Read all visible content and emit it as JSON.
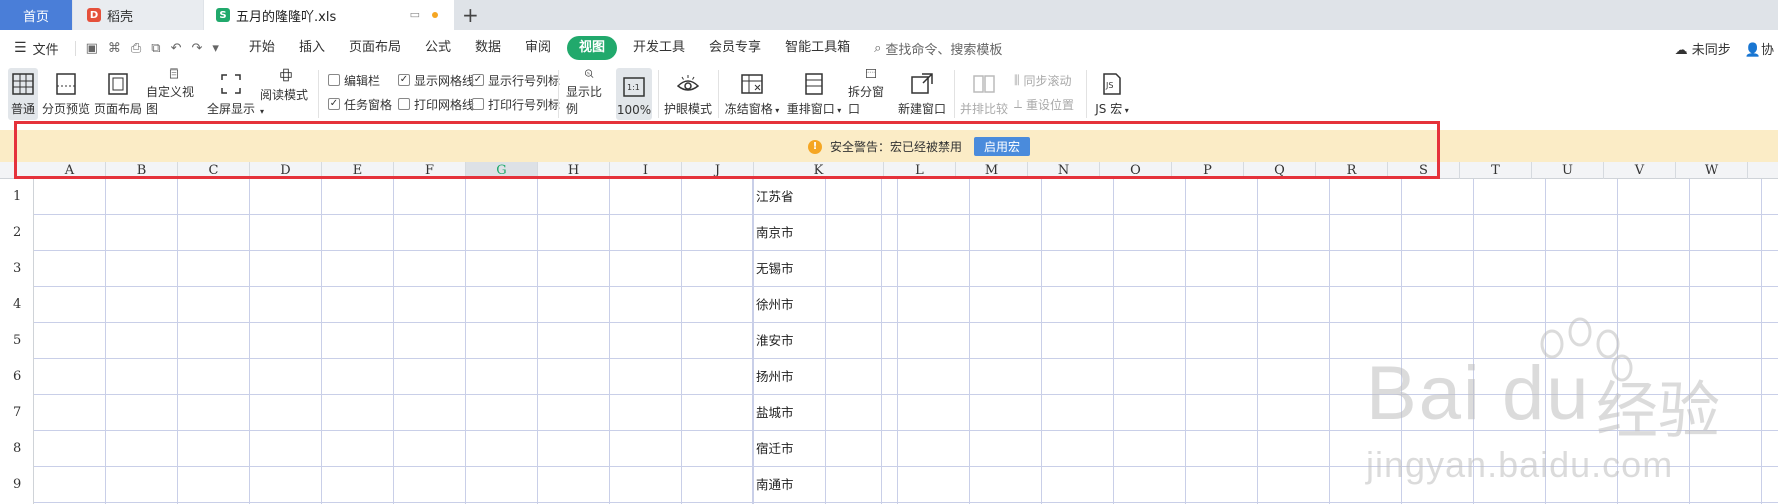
{
  "tabs": {
    "home": "首页",
    "doc1": "稻壳",
    "active": "五月的隆隆吖.xls",
    "new_tab": "+"
  },
  "menu": {
    "file": "文件",
    "items": [
      "开始",
      "插入",
      "页面布局",
      "公式",
      "数据",
      "审阅",
      "视图",
      "开发工具",
      "会员专享",
      "智能工具箱"
    ],
    "active_item": "视图",
    "search": "查找命令、搜索模板",
    "sync": "未同步",
    "collab": "协"
  },
  "ribbon": {
    "normal": "普通",
    "page_break": "分页预览",
    "page_layout": "页面布局",
    "custom_view": "自定义视图",
    "fullscreen": "全屏显示",
    "reading_mode": "阅读模式",
    "edit_bar": "编辑栏",
    "task_pane": "任务窗格",
    "show_gridlines": "显示网格线",
    "print_gridlines": "打印网格线",
    "show_headers": "显示行号列标",
    "print_headers": "打印行号列标",
    "zoom": "显示比例",
    "zoom_100": "100%",
    "zoom_100_icon": "1:1",
    "eye_protect": "护眼模式",
    "freeze": "冻结窗格",
    "rearrange": "重排窗口",
    "split": "拆分窗口",
    "new_window": "新建窗口",
    "side_by_side": "并排比较",
    "sync_scroll": "同步滚动",
    "reset_position": "重设位置",
    "js_macro": "JS 宏"
  },
  "warning": {
    "text": "安全警告：宏已经被禁用",
    "button": "启用宏"
  },
  "grid": {
    "columns": [
      "A",
      "B",
      "C",
      "D",
      "E",
      "F",
      "G",
      "H",
      "I",
      "J",
      "K",
      "L",
      "M",
      "N",
      "O",
      "P",
      "Q",
      "R",
      "S",
      "T",
      "U",
      "V",
      "W"
    ],
    "selected_column": "G",
    "rows": [
      "1",
      "2",
      "3",
      "4",
      "5",
      "6",
      "7",
      "8",
      "9"
    ],
    "k_values": [
      "江苏省",
      "南京市",
      "无锡市",
      "徐州市",
      "淮安市",
      "扬州市",
      "盐城市",
      "宿迁市",
      "南通市"
    ]
  },
  "watermark": {
    "brand": "Bai",
    "brand2": "du",
    "cn": "经验",
    "url": "jingyan.baidu.com"
  }
}
